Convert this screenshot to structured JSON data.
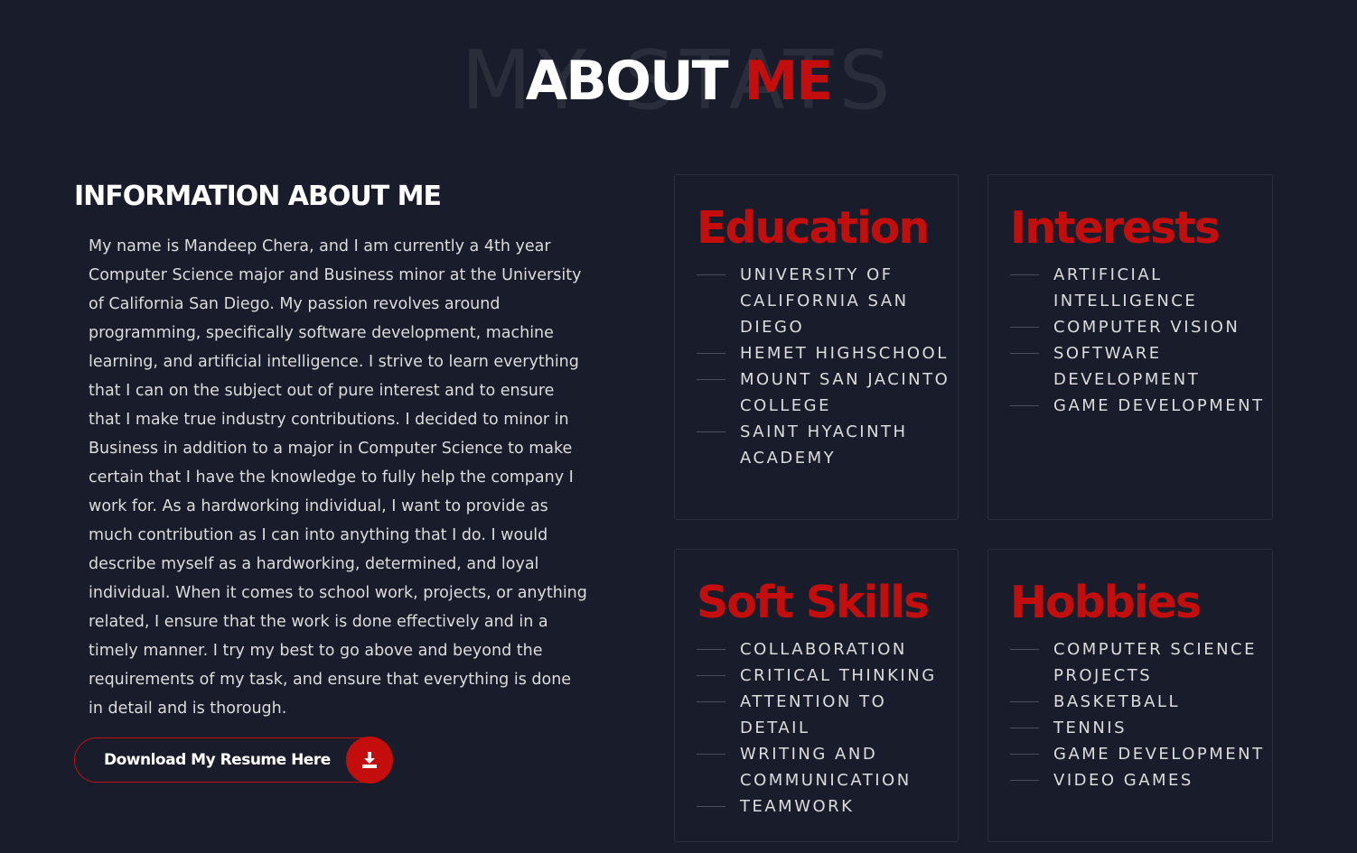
{
  "header": {
    "background_word": "MY STATS",
    "title_white": "ABOUT",
    "title_red": "ME"
  },
  "info": {
    "heading": "INFORMATION ABOUT ME",
    "body": "My name is Mandeep Chera, and I am currently a 4th year Computer Science major and Business minor at the University of California San Diego. My passion revolves around programming, specifically software development, machine learning, and artificial intelligence. I strive to learn everything that I can on the subject out of pure interest and to ensure that I make true industry contributions. I decided to minor in Business in addition to a major in Computer Science to make certain that I have the knowledge to fully help the company I work for. As a hardworking individual, I want to provide as much contribution as I can into anything that I do. I would describe myself as a hardworking, determined, and loyal individual. When it comes to school work, projects, or anything related, I ensure that the work is done effectively and in a timely manner. I try my best to go above and beyond the requirements of my task, and ensure that everything is done in detail and is thorough."
  },
  "download": {
    "label": "Download My Resume Here",
    "icon": "download-icon"
  },
  "cards": {
    "education": {
      "title": "Education",
      "items": [
        "University of California San Diego",
        "Hemet Highschool",
        "Mount San Jacinto College",
        "Saint Hyacinth Academy"
      ]
    },
    "interests": {
      "title": "Interests",
      "items": [
        "Artificial Intelligence",
        "Computer Vision",
        "Software Development",
        "Game Development"
      ]
    },
    "soft_skills": {
      "title": "Soft Skills",
      "items": [
        "Collaboration",
        "Critical Thinking",
        "Attention to Detail",
        "Writing and Communication",
        "Teamwork"
      ]
    },
    "hobbies": {
      "title": "Hobbies",
      "items": [
        "Computer Science Projects",
        "Basketball",
        "Tennis",
        "Game Development",
        "Video Games"
      ]
    }
  },
  "colors": {
    "background": "#191d2b",
    "accent": "#c40e0e",
    "text": "#dcdcdc",
    "card_border": "#2a2f3f"
  }
}
